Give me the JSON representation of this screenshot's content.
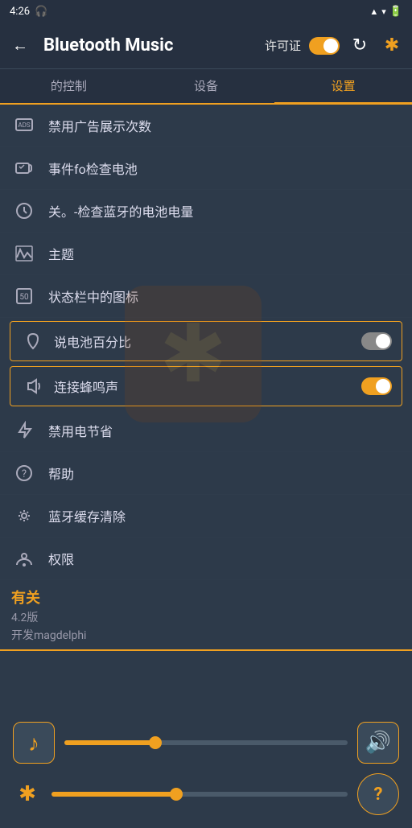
{
  "status": {
    "time": "4:26",
    "headphones": "🎧",
    "signal": "▲▲▲▲",
    "battery": "🔋"
  },
  "header": {
    "back_icon": "←",
    "title": "Bluetooth Music",
    "license_label": "许可证",
    "refresh_icon": "↻",
    "bluetooth_icon": "✱"
  },
  "tabs": [
    {
      "id": "controls",
      "label": "的控制",
      "active": false
    },
    {
      "id": "devices",
      "label": "设备",
      "active": false
    },
    {
      "id": "settings",
      "label": "设置",
      "active": true
    }
  ],
  "settings": {
    "items": [
      {
        "icon": "📢",
        "label": "禁用广告展示次数"
      },
      {
        "icon": "🔔",
        "label": "事件fo检查电池"
      },
      {
        "icon": "⏰",
        "label": "关。-检查蓝牙的电池电量"
      },
      {
        "icon": "🎨",
        "label": "主题"
      },
      {
        "icon": "🔢",
        "label": "状态栏中的图标"
      }
    ],
    "toggle_items": [
      {
        "label": "说电池百分比",
        "state": "off"
      },
      {
        "label": "连接蜂鸣声",
        "state": "on"
      }
    ],
    "plain_items": [
      {
        "icon": "⚡",
        "label": "禁用电节省"
      },
      {
        "icon": "❓",
        "label": "帮助"
      },
      {
        "icon": "🔧",
        "label": "蓝牙缓存清除"
      },
      {
        "icon": "📍",
        "label": "权限"
      }
    ]
  },
  "about": {
    "section_label": "有关",
    "version": "4.2版",
    "developer": "开发magdelphi"
  },
  "bottom": {
    "music_icon": "♪",
    "volume_icon": "🔊",
    "help_icon": "?",
    "bluetooth_icon": "✱",
    "music_slider_pct": 32,
    "bt_slider_pct": 42
  }
}
